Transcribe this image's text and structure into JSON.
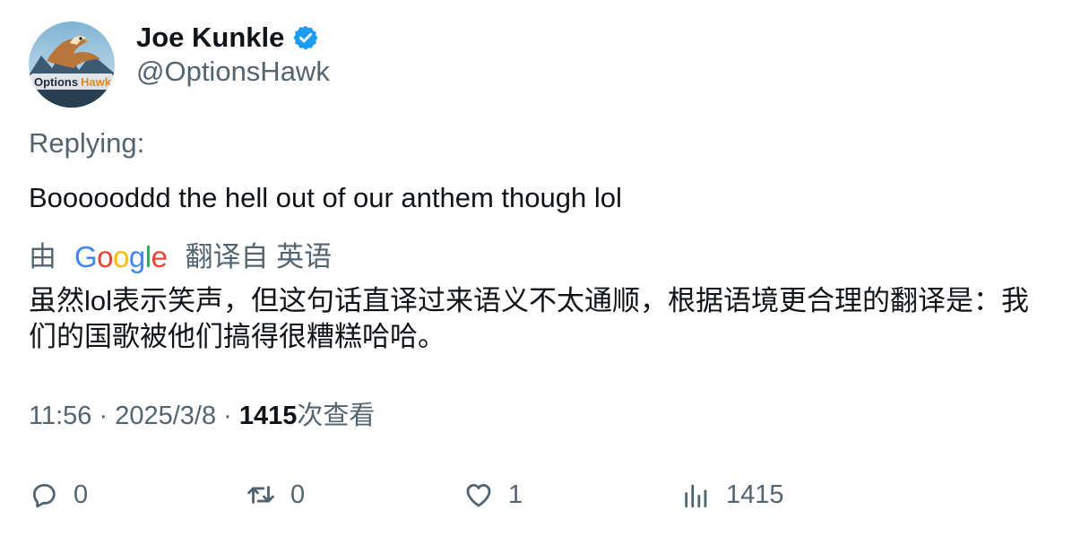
{
  "author": {
    "display_name": "Joe Kunkle",
    "handle": "@OptionsHawk",
    "avatar_text": "OptionsHawk",
    "verified": true
  },
  "tweet": {
    "replying_label": "Replying:",
    "text": "Boooooddd the hell out of our anthem though lol"
  },
  "translation": {
    "by_label": "由",
    "provider": "Google",
    "from_label": "翻译自 英语",
    "text": "虽然lol表示笑声，但这句话直译过来语义不太通顺，根据语境更合理的翻译是：我们的国歌被他们搞得很糟糕哈哈。"
  },
  "meta": {
    "time": "11:56",
    "separator": " · ",
    "date": "2025/3/8",
    "views_count": "1415",
    "views_label": "次查看"
  },
  "actions": {
    "replies": "0",
    "retweets": "0",
    "likes": "1",
    "views": "1415"
  },
  "colors": {
    "text_primary": "#0f1419",
    "text_secondary": "#536471",
    "verified_blue": "#1d9bf0",
    "google_blue": "#4285F4",
    "google_red": "#EA4335",
    "google_yellow": "#FBBC05",
    "google_green": "#34A853"
  }
}
